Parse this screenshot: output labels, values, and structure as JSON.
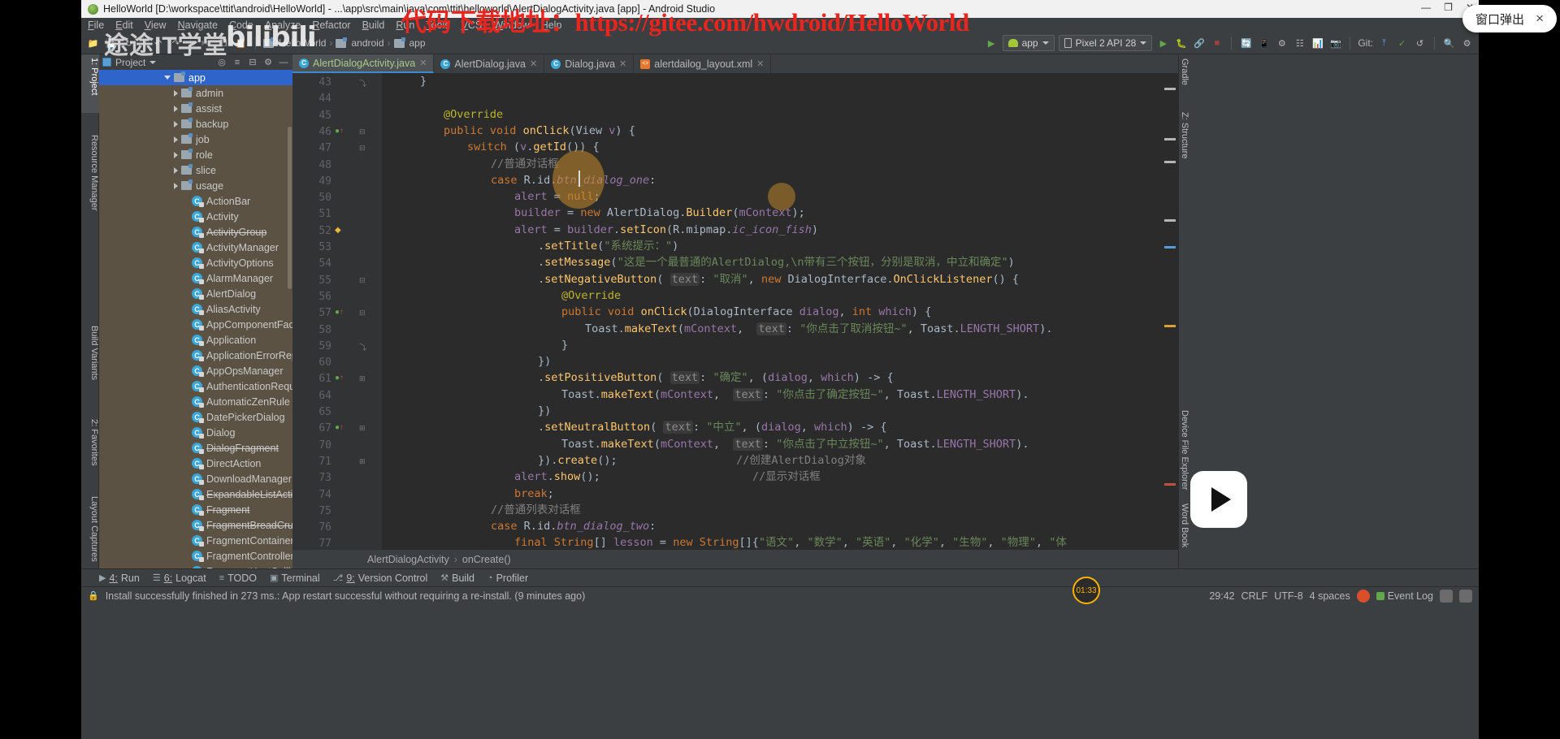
{
  "window": {
    "title": "HelloWorld [D:\\workspace\\ttit\\android\\HelloWorld] - ...\\app\\src\\main\\java\\com\\ttit\\helloworld\\AlertDialogActivity.java [app] - Android Studio",
    "minimize": "—",
    "maximize": "❐",
    "close": "✕"
  },
  "overlays": {
    "red_banner": "代码下载地址：https://gitee.com/hwdroid/HelloWorld",
    "popup_label": "窗口弹出",
    "popup_close": "×",
    "watermark_text": "途途IT学堂",
    "watermark_brand": "bilibili",
    "recording_time": "01:33"
  },
  "menubar": [
    "File",
    "Edit",
    "View",
    "Navigate",
    "Code",
    "Analyze",
    "Refactor",
    "Build",
    "Run",
    "Tools",
    "VCS",
    "Window",
    "Help"
  ],
  "toolbar": {
    "breadcrumb": [
      "HelloWorld",
      "android",
      "app"
    ],
    "run_config": "app",
    "device": "Pixel 2 API 28",
    "vcs_label": "Git:"
  },
  "leftstrip": {
    "tabs": [
      "1: Project",
      "Resource Manager",
      "Build Variants",
      "2: Favorites",
      "Layout Captures"
    ]
  },
  "rightstrip": {
    "tabs": [
      "Gradle",
      "Z: Structure",
      "Device File Explorer",
      "Word Book"
    ]
  },
  "project": {
    "title": "Project",
    "root": "app",
    "folders": [
      "admin",
      "assist",
      "backup",
      "job",
      "role",
      "slice",
      "usage"
    ],
    "classes": [
      {
        "name": "ActionBar",
        "strike": false
      },
      {
        "name": "Activity",
        "strike": false
      },
      {
        "name": "ActivityGroup",
        "strike": true
      },
      {
        "name": "ActivityManager",
        "strike": false
      },
      {
        "name": "ActivityOptions",
        "strike": false
      },
      {
        "name": "AlarmManager",
        "strike": false
      },
      {
        "name": "AlertDialog",
        "strike": false
      },
      {
        "name": "AliasActivity",
        "strike": false
      },
      {
        "name": "AppComponentFactory",
        "strike": false
      },
      {
        "name": "Application",
        "strike": false
      },
      {
        "name": "ApplicationErrorReport",
        "strike": false
      },
      {
        "name": "AppOpsManager",
        "strike": false
      },
      {
        "name": "AuthenticationRequiredException",
        "strike": false
      },
      {
        "name": "AutomaticZenRule",
        "strike": false
      },
      {
        "name": "DatePickerDialog",
        "strike": false
      },
      {
        "name": "Dialog",
        "strike": false
      },
      {
        "name": "DialogFragment",
        "strike": true
      },
      {
        "name": "DirectAction",
        "strike": false
      },
      {
        "name": "DownloadManager",
        "strike": false
      },
      {
        "name": "ExpandableListActivity",
        "strike": true
      },
      {
        "name": "Fragment",
        "strike": true
      },
      {
        "name": "FragmentBreadCrumbs",
        "strike": true
      },
      {
        "name": "FragmentContainer",
        "strike": false
      },
      {
        "name": "FragmentController",
        "strike": false
      },
      {
        "name": "FragmentHostCallback",
        "strike": true
      }
    ]
  },
  "tabs": [
    {
      "label": "AlertDialogActivity.java",
      "type": "java",
      "active": true
    },
    {
      "label": "AlertDialog.java",
      "type": "java",
      "active": false
    },
    {
      "label": "Dialog.java",
      "type": "java",
      "active": false
    },
    {
      "label": "alertdailog_layout.xml",
      "type": "xml",
      "active": false
    }
  ],
  "editor": {
    "breadcrumb": [
      "AlertDialogActivity",
      "onCreate()"
    ],
    "lines": [
      {
        "no": "43",
        "indent": 1,
        "gutter": "",
        "fold": "end"
      },
      {
        "no": "44",
        "indent": 0,
        "gutter": ""
      },
      {
        "no": "45",
        "indent": 2,
        "gutter": ""
      },
      {
        "no": "46",
        "indent": 2,
        "gutter": "override",
        "fold": "start"
      },
      {
        "no": "47",
        "indent": 3,
        "gutter": "",
        "fold": "start"
      },
      {
        "no": "48",
        "indent": 4,
        "gutter": ""
      },
      {
        "no": "49",
        "indent": 4,
        "gutter": ""
      },
      {
        "no": "50",
        "indent": 5,
        "gutter": ""
      },
      {
        "no": "51",
        "indent": 5,
        "gutter": ""
      },
      {
        "no": "52",
        "indent": 5,
        "gutter": "bookmark"
      },
      {
        "no": "53",
        "indent": 6,
        "gutter": ""
      },
      {
        "no": "54",
        "indent": 6,
        "gutter": ""
      },
      {
        "no": "55",
        "indent": 6,
        "gutter": "",
        "fold": "start"
      },
      {
        "no": "56",
        "indent": 7,
        "gutter": ""
      },
      {
        "no": "57",
        "indent": 7,
        "gutter": "override",
        "fold": "start"
      },
      {
        "no": "58",
        "indent": 8,
        "gutter": ""
      },
      {
        "no": "59",
        "indent": 7,
        "gutter": "",
        "fold": "end"
      },
      {
        "no": "60",
        "indent": 6,
        "gutter": ""
      },
      {
        "no": "61",
        "indent": 6,
        "gutter": "override",
        "fold": "plus"
      },
      {
        "no": "64",
        "indent": 7,
        "gutter": ""
      },
      {
        "no": "65",
        "indent": 6,
        "gutter": ""
      },
      {
        "no": "67",
        "indent": 6,
        "gutter": "override",
        "fold": "plus"
      },
      {
        "no": "70",
        "indent": 7,
        "gutter": ""
      },
      {
        "no": "71",
        "indent": 6,
        "gutter": "",
        "fold": "plus"
      },
      {
        "no": "73",
        "indent": 5,
        "gutter": ""
      },
      {
        "no": "74",
        "indent": 5,
        "gutter": ""
      },
      {
        "no": "75",
        "indent": 4,
        "gutter": ""
      },
      {
        "no": "76",
        "indent": 4,
        "gutter": ""
      },
      {
        "no": "77",
        "indent": 5,
        "gutter": ""
      }
    ],
    "code_text": [
      "}",
      "",
      "@Override",
      "public void onClick(View v) {",
      "switch (v.getId()) {",
      "//普通对话框",
      "case R.id.btn_dialog_one:",
      "alert = null;",
      "builder = new AlertDialog.Builder(mContext);",
      "alert = builder.setIcon(R.mipmap.ic_icon_fish)",
      ".setTitle(\"系统提示：\")",
      ".setMessage(\"这是一个最普通的AlertDialog,\\n带有三个按钮，分别是取消，中立和确定\")",
      ".setNegativeButton( text: \"取消\", new DialogInterface.OnClickListener() {",
      "@Override",
      "public void onClick(DialogInterface dialog, int which) {",
      "Toast.makeText(mContext,  text: \"你点击了取消按钮~\", Toast.LENGTH_SHORT).",
      "}",
      "})",
      ".setPositiveButton( text: \"确定\", (dialog, which) -> {",
      "Toast.makeText(mContext,  text: \"你点击了确定按钮~\", Toast.LENGTH_SHORT).",
      "})",
      ".setNeutralButton( text: \"中立\", (dialog, which) -> {",
      "Toast.makeText(mContext,  text: \"你点击了中立按钮~\", Toast.LENGTH_SHORT).",
      "}).create();                  //创建AlertDialog对象",
      "alert.show();                       //显示对话框",
      "break;",
      "//普通列表对话框",
      "case R.id.btn_dialog_two:",
      "final String[] lesson = new String[]{\"语文\", \"数学\", \"英语\", \"化学\", \"生物\", \"物理\", \"体"
    ]
  },
  "bottombar": {
    "items": [
      {
        "key": "4",
        "label": "Run",
        "icon": "run-icon"
      },
      {
        "key": "6",
        "label": "Logcat",
        "icon": "logcat-icon"
      },
      {
        "key": "",
        "label": "TODO",
        "icon": "todo-icon"
      },
      {
        "key": "",
        "label": "Terminal",
        "icon": "terminal-icon"
      },
      {
        "key": "9",
        "label": "Version Control",
        "icon": "vcs-icon"
      },
      {
        "key": "",
        "label": "Build",
        "icon": "build-icon"
      },
      {
        "key": "",
        "label": "Profiler",
        "icon": "profiler-icon"
      }
    ]
  },
  "statusbar": {
    "message": "Install successfully finished in 273 ms.: App restart successful without requiring a re-install. (9 minutes ago)",
    "position": "29:42",
    "line_sep": "CRLF",
    "encoding": "UTF-8",
    "indent": "4 spaces",
    "event_log": "Event Log",
    "lock": "🔒"
  }
}
